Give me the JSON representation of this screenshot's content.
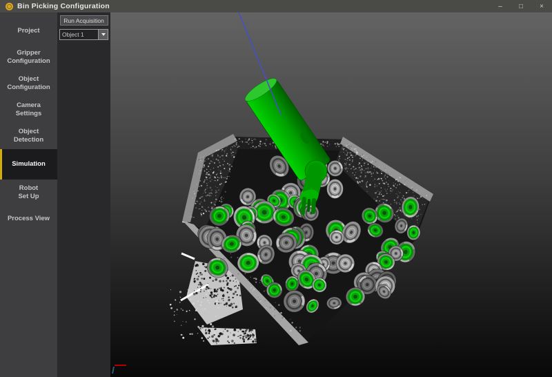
{
  "window": {
    "title": "Bin Picking Configuration",
    "controls": {
      "minimize": "–",
      "maximize": "□",
      "close": "×"
    }
  },
  "sidebar": {
    "active_item": "Simulation",
    "accent_color": "#d4a90a",
    "items": [
      {
        "label": "Project"
      },
      {
        "label": "Gripper\nConfiguration"
      },
      {
        "label": "Object\nConfiguration"
      },
      {
        "label": "Camera\nSettings"
      },
      {
        "label": "Object\nDetection"
      },
      {
        "label": "Simulation"
      },
      {
        "label": "Robot\nSet Up"
      },
      {
        "label": "Process View"
      }
    ]
  },
  "toolbar": {
    "run_button_label": "Run Acquisition",
    "object_dropdown_value": "Object 1"
  },
  "viewport": {
    "scene": {
      "background_top": "#636363",
      "background_mid": "#3e3e3e",
      "background_bottom": "#080808",
      "robot_tool_color": "#00a800",
      "approach_line_color": "#4650c0",
      "bin_wall_color": "#252525",
      "bin_rim_color": "#9a9a9a",
      "detected_overlay_color": "#009e00",
      "scan_patch_color": "#c6c6c6",
      "axis_x_color": "#b40000",
      "axis_y_color": "#2a5a78",
      "part_count": 80,
      "detected_fraction": 0.46
    }
  }
}
